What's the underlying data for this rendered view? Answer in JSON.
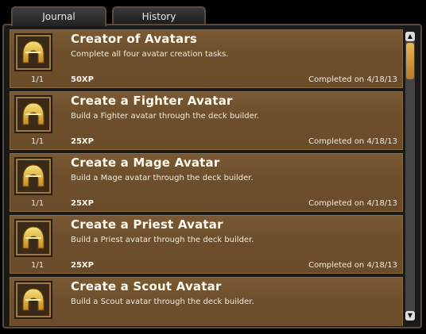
{
  "tabs": [
    {
      "label": "Journal",
      "active": true
    },
    {
      "label": "History",
      "active": false
    }
  ],
  "achievements": [
    {
      "title": "Creator of Avatars",
      "description": "Complete all four avatar creation tasks.",
      "count": "1/1",
      "xp": "50XP",
      "completed": "Completed on 4/18/13",
      "icon": "helmet-icon"
    },
    {
      "title": "Create a Fighter Avatar",
      "description": "Build a Fighter avatar through the deck builder.",
      "count": "1/1",
      "xp": "25XP",
      "completed": "Completed on 4/18/13",
      "icon": "helmet-icon"
    },
    {
      "title": "Create a Mage Avatar",
      "description": "Build a Mage avatar through the deck builder.",
      "count": "1/1",
      "xp": "25XP",
      "completed": "Completed on 4/18/13",
      "icon": "helmet-icon"
    },
    {
      "title": "Create a Priest Avatar",
      "description": "Build a Priest avatar through the deck builder.",
      "count": "1/1",
      "xp": "25XP",
      "completed": "Completed on 4/18/13",
      "icon": "helmet-icon"
    },
    {
      "title": "Create a Scout Avatar",
      "description": "Build a Scout avatar through the deck builder.",
      "count": "",
      "xp": "",
      "completed": "",
      "icon": "helmet-icon"
    }
  ],
  "scrollbar": {
    "up_icon": "arrow-up-icon",
    "down_icon": "arrow-down-icon"
  },
  "colors": {
    "row_bg": "#6d4f2c",
    "thumb": "#d59a45",
    "background": "#1a1a1a"
  }
}
